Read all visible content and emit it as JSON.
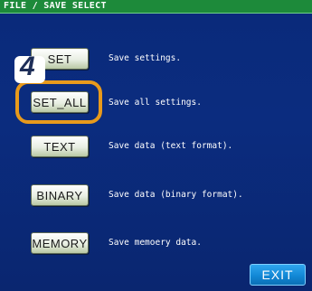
{
  "header": {
    "title": "FILE / SAVE SELECT"
  },
  "rows": [
    {
      "button_label": "SET",
      "description": "Save settings."
    },
    {
      "button_label": "SET_ALL",
      "description": "Save all settings."
    },
    {
      "button_label": "TEXT",
      "description": "Save data (text format)."
    },
    {
      "button_label": "BINARY",
      "description": "Save data (binary format)."
    },
    {
      "button_label": "MEMORY",
      "description": "Save memoery data."
    }
  ],
  "annotation": {
    "step_number": "4",
    "highlighted_button": "SET_ALL",
    "ring_color": "#e89a1c"
  },
  "exit": {
    "label": "EXIT"
  },
  "colors": {
    "background": "#0b2c7f",
    "title_bar": "#1d8a3a",
    "exit_button": "#1288d6"
  }
}
